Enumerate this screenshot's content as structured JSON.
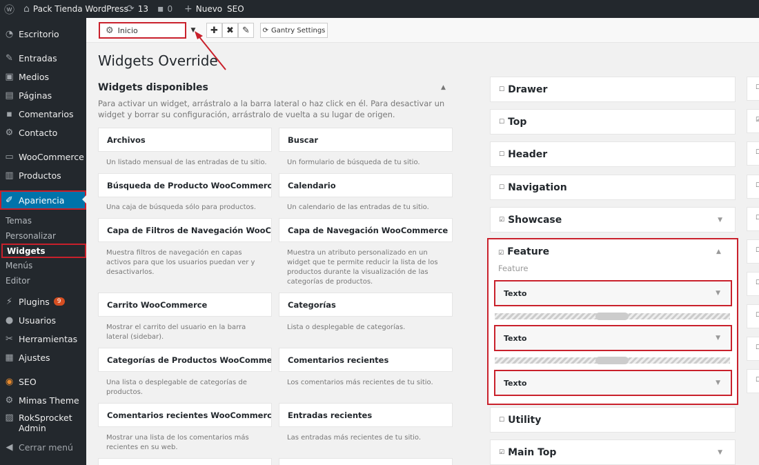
{
  "adminbar": {
    "site": "Pack Tienda WordPress",
    "updates": "13",
    "comments": "0",
    "new": "Nuevo",
    "seo": "SEO"
  },
  "menu": {
    "escritorio": "Escritorio",
    "entradas": "Entradas",
    "medios": "Medios",
    "paginas": "Páginas",
    "comentarios": "Comentarios",
    "contacto": "Contacto",
    "woocommerce": "WooCommerce",
    "productos": "Productos",
    "apariencia": "Apariencia",
    "temas": "Temas",
    "personalizar": "Personalizar",
    "widgets": "Widgets",
    "menus": "Menús",
    "editor": "Editor",
    "plugins": "Plugins",
    "plugins_badge": "9",
    "usuarios": "Usuarios",
    "herramientas": "Herramientas",
    "ajustes": "Ajustes",
    "seo": "SEO",
    "mimas": "Mimas Theme",
    "rok1": "RokSprocket",
    "rok2": "Admin",
    "cerrar": "Cerrar menú"
  },
  "toolbar": {
    "select": "Inicio",
    "gantry": "Gantry Settings"
  },
  "page": {
    "title": "Widgets Override"
  },
  "available": {
    "title": "Widgets disponibles",
    "desc": "Para activar un widget, arrástralo a la barra lateral o haz click en él. Para desactivar un widget y borrar su configuración, arrástralo de vuelta a su lugar de origen."
  },
  "widgets": [
    {
      "name": "Archivos",
      "desc": "Un listado mensual de las entradas de tu sitio."
    },
    {
      "name": "Buscar",
      "desc": "Un formulario de búsqueda de tu sitio."
    },
    {
      "name": "Búsqueda de Producto WooCommerce",
      "desc": "Una caja de búsqueda sólo para productos."
    },
    {
      "name": "Calendario",
      "desc": "Un calendario de las entradas de tu sitio."
    },
    {
      "name": "Capa de Filtros de Navegación WooComme...",
      "desc": "Muestra filtros de navegación en capas activos para que los usuarios puedan ver y desactivarlos."
    },
    {
      "name": "Capa de Navegación WooCommerce",
      "desc": "Muestra un atributo personalizado en un widget que te permite reducir la lista de los productos durante la visualización de las categorías de productos."
    },
    {
      "name": "Carrito WooCommerce",
      "desc": "Mostrar el carrito del usuario en la barra lateral (sidebar)."
    },
    {
      "name": "Categorías",
      "desc": "Lista o desplegable de categorías."
    },
    {
      "name": "Categorías de Productos WooCommerce",
      "desc": "Una lista o desplegable de categorías de productos."
    },
    {
      "name": "Comentarios recientes",
      "desc": "Los comentarios más recientes de tu sitio."
    },
    {
      "name": "Comentarios recientes WooCommerce",
      "desc": "Mostrar una lista de los comentarios más recientes en su web."
    },
    {
      "name": "Entradas recientes",
      "desc": "Las entradas más recientes de tu sitio."
    }
  ],
  "sidebars": {
    "drawer": "Drawer",
    "top": "Top",
    "header": "Header",
    "navigation": "Navigation",
    "showcase": "Showcase",
    "feature": "Feature",
    "feature_desc": "Feature",
    "texto": "Texto",
    "utility": "Utility",
    "maintop": "Main Top"
  }
}
